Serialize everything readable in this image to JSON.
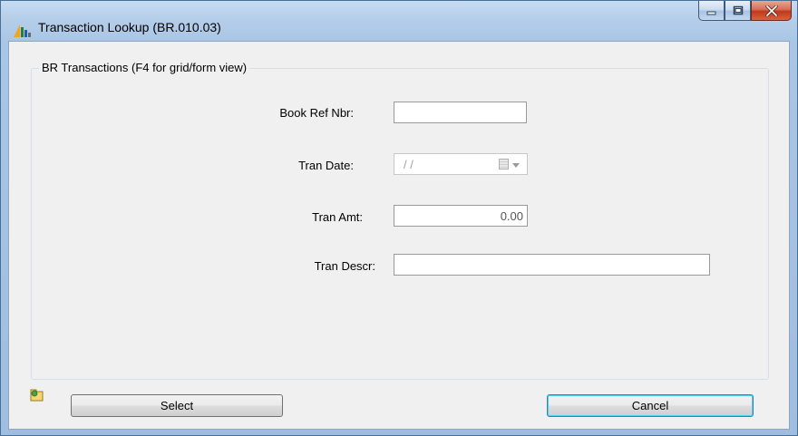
{
  "window": {
    "title": "Transaction Lookup (BR.010.03)",
    "app_icon": "chart-bars-icon",
    "controls": {
      "minimize_icon": "minimize-icon",
      "maximize_icon": "maximize-icon",
      "close_icon": "close-icon"
    }
  },
  "group": {
    "title": "BR Transactions (F4 for grid/form view)"
  },
  "form": {
    "book_ref": {
      "label": "Book Ref Nbr:",
      "value": ""
    },
    "tran_date": {
      "label": "Tran Date:",
      "value": "/ /"
    },
    "tran_amt": {
      "label": "Tran Amt:",
      "value": "0.00"
    },
    "tran_descr": {
      "label": "Tran Descr:",
      "value": ""
    }
  },
  "footer": {
    "status_icon": "folder-icon",
    "select_label": "Select",
    "cancel_label": "Cancel"
  },
  "colors": {
    "titlebar": "#b5cee9",
    "client_bg": "#f0f0f0",
    "close_button": "#c7482b",
    "default_button_border": "#3c7fb1"
  }
}
